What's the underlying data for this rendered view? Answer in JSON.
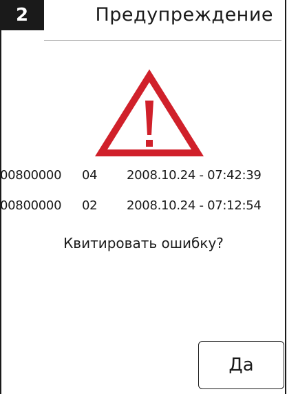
{
  "header": {
    "page_number": "2",
    "title": "Предупреждение"
  },
  "warning": {
    "icon": "warning-triangle-icon",
    "color": "#d0202a"
  },
  "entries": [
    {
      "code": "00800000",
      "sub": "04",
      "timestamp": "2008.10.24 - 07:42:39"
    },
    {
      "code": "00800000",
      "sub": "02",
      "timestamp": "2008.10.24 - 07:12:54"
    }
  ],
  "question": "Квитировать ошибку?",
  "actions": {
    "yes_label": "Да"
  }
}
